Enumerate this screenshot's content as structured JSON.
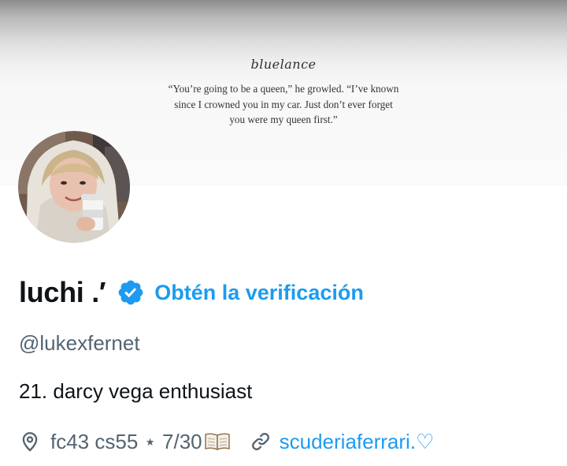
{
  "banner": {
    "signature": "bluelance",
    "quote_lines": [
      "“You’re going to be a queen,” he growled. “I’ve known",
      "since I crowned you in my car. Just don’t ever forget",
      "you were my queen first.”"
    ]
  },
  "profile": {
    "display_name": "luchi .′",
    "verified_icon": "verified-badge-icon",
    "get_verified_label": "Obtén la verificación",
    "handle": "@lukexfernet",
    "bio": "21. darcy vega enthusiast",
    "location": "fc43 cs55 ⋆ 7/30",
    "location_icon": "location-pin-icon",
    "book_icon": "open-book-icon",
    "link_icon": "link-icon",
    "website": "scuderiaferrari.♡"
  },
  "colors": {
    "accent": "#1d9bf0",
    "secondary_text": "#536471",
    "primary_text": "#0f1419"
  }
}
